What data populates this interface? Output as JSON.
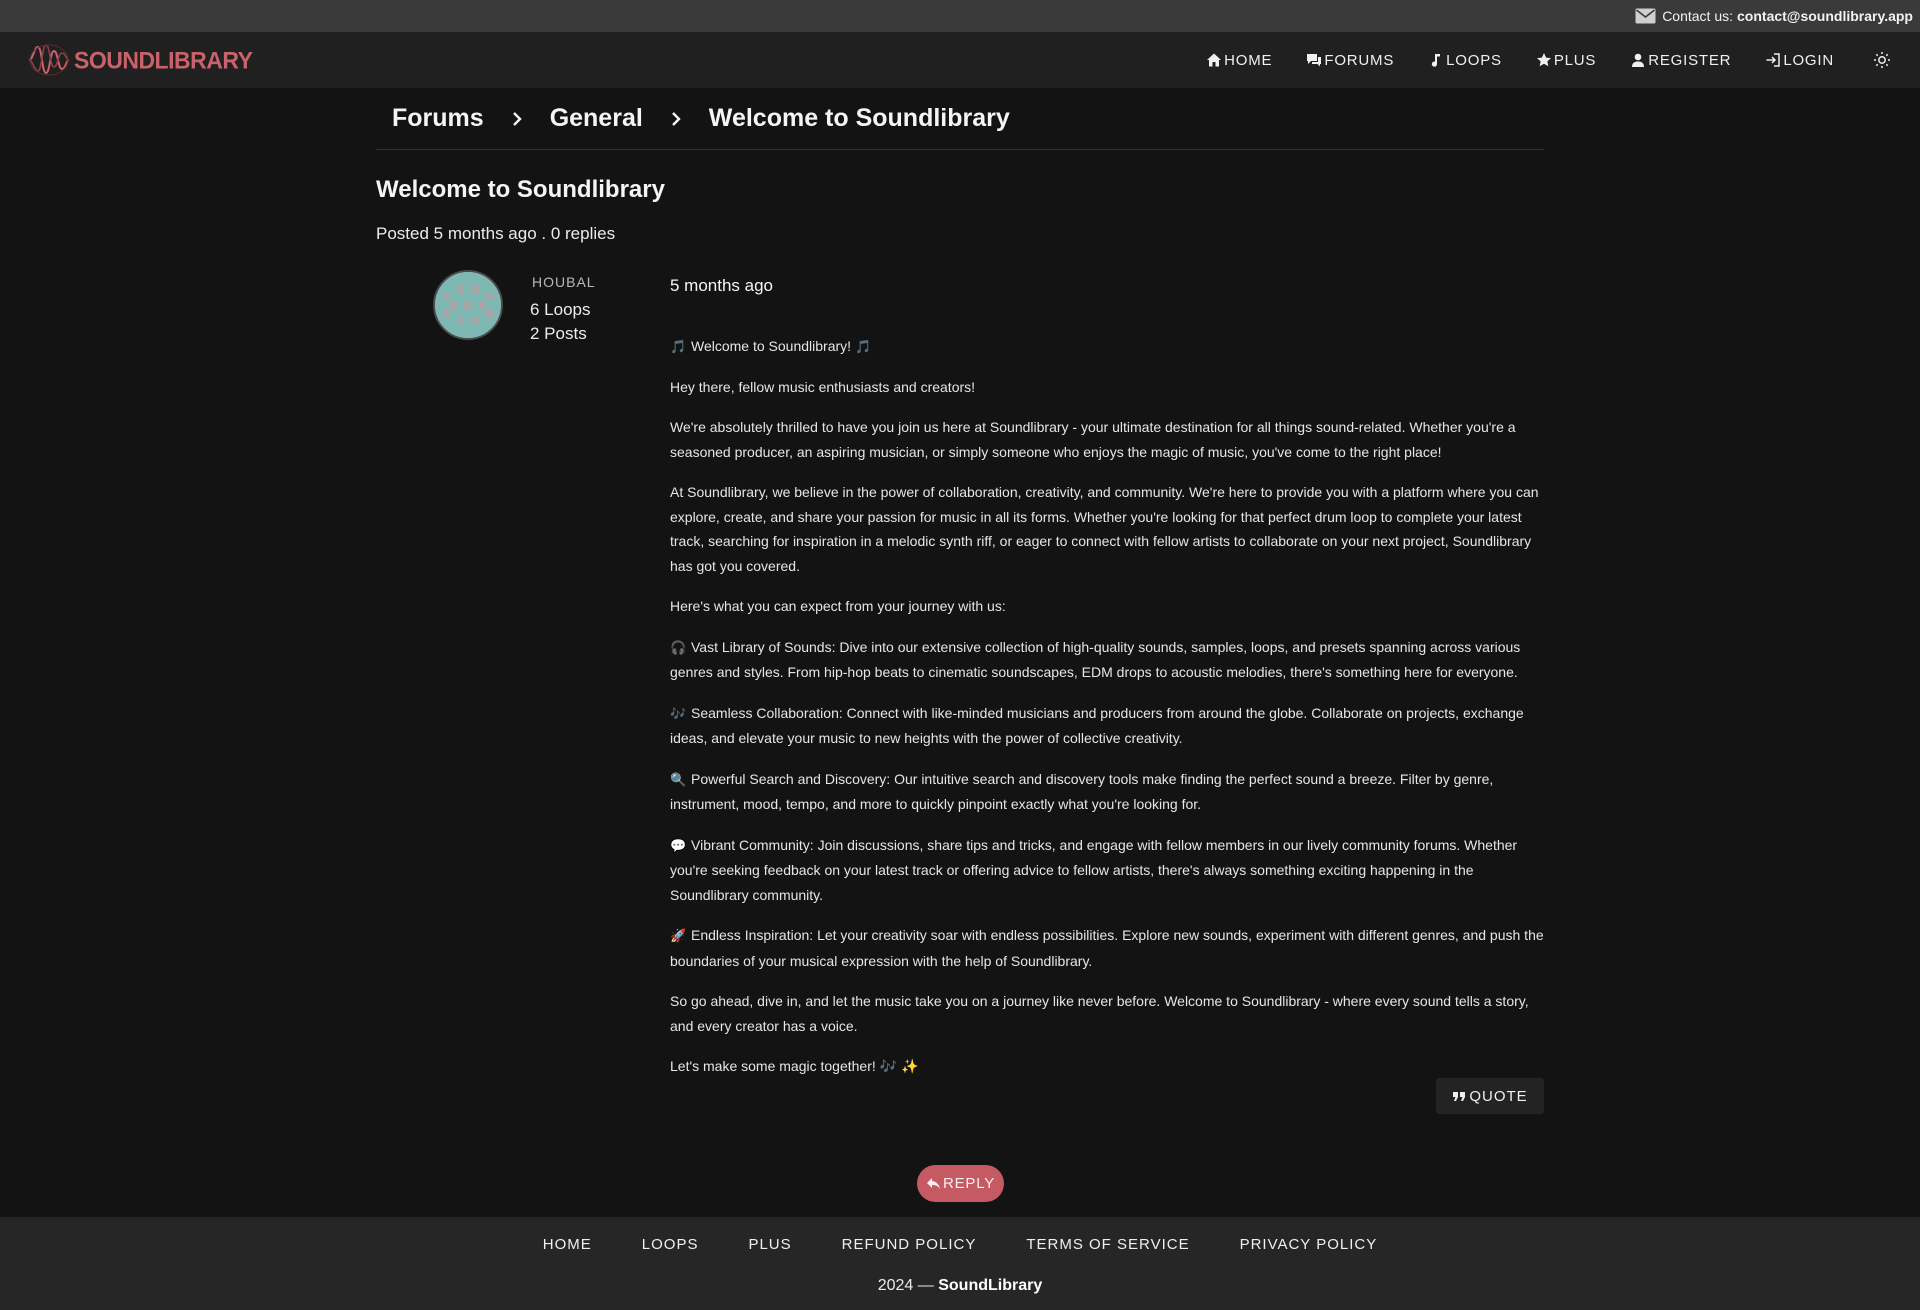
{
  "topbar": {
    "contact_label": "Contact us:",
    "contact_email": "contact@soundlibrary.app",
    "icon": "mail-icon"
  },
  "brand": {
    "name": "SOUNDLIBRARY",
    "color": "#c9626b"
  },
  "nav": {
    "items": [
      {
        "label": "HOME",
        "icon": "home-icon"
      },
      {
        "label": "FORUMS",
        "icon": "chat-icon"
      },
      {
        "label": "LOOPS",
        "icon": "music-note-icon"
      },
      {
        "label": "PLUS",
        "icon": "star-icon"
      },
      {
        "label": "REGISTER",
        "icon": "user-icon"
      },
      {
        "label": "LOGIN",
        "icon": "login-icon"
      }
    ],
    "theme_icon": "sun-icon"
  },
  "breadcrumb": [
    "Forums",
    "General",
    "Welcome to Soundlibrary"
  ],
  "thread": {
    "title": "Welcome to Soundlibrary",
    "meta": "Posted 5 months ago . 0 replies"
  },
  "post": {
    "author": {
      "name": "HOUBAL",
      "loops": "6 Loops",
      "posts": "2 Posts"
    },
    "time": "5 months ago",
    "paragraphs": [
      {
        "pre": "🎵",
        "text": "Welcome to Soundlibrary!",
        "post": "🎵"
      },
      {
        "pre": "",
        "text": "Hey there, fellow music enthusiasts and creators!",
        "post": ""
      },
      {
        "pre": "",
        "text": "We're absolutely thrilled to have you join us here at Soundlibrary - your ultimate destination for all things sound-related. Whether you're a seasoned producer, an aspiring musician, or simply someone who enjoys the magic of music, you've come to the right place!",
        "post": ""
      },
      {
        "pre": "",
        "text": "At Soundlibrary, we believe in the power of collaboration, creativity, and community. We're here to provide you with a platform where you can explore, create, and share your passion for music in all its forms. Whether you're looking for that perfect drum loop to complete your latest track, searching for inspiration in a melodic synth riff, or eager to connect with fellow artists to collaborate on your next project, Soundlibrary has got you covered.",
        "post": ""
      },
      {
        "pre": "",
        "text": "Here's what you can expect from your journey with us:",
        "post": ""
      },
      {
        "pre": "🎧",
        "text": "Vast Library of Sounds: Dive into our extensive collection of high-quality sounds, samples, loops, and presets spanning across various genres and styles. From hip-hop beats to cinematic soundscapes, EDM drops to acoustic melodies, there's something here for everyone.",
        "post": ""
      },
      {
        "pre": "🎶",
        "text": "Seamless Collaboration: Connect with like-minded musicians and producers from around the globe. Collaborate on projects, exchange ideas, and elevate your music to new heights with the power of collective creativity.",
        "post": ""
      },
      {
        "pre": "🔍",
        "text": "Powerful Search and Discovery: Our intuitive search and discovery tools make finding the perfect sound a breeze. Filter by genre, instrument, mood, tempo, and more to quickly pinpoint exactly what you're looking for.",
        "post": ""
      },
      {
        "pre": "💬",
        "text": "Vibrant Community: Join discussions, share tips and tricks, and engage with fellow members in our lively community forums. Whether you're seeking feedback on your latest track or offering advice to fellow artists, there's always something exciting happening in the Soundlibrary community.",
        "post": ""
      },
      {
        "pre": "🚀",
        "text": "Endless Inspiration: Let your creativity soar with endless possibilities. Explore new sounds, experiment with different genres, and push the boundaries of your musical expression with the help of Soundlibrary.",
        "post": ""
      },
      {
        "pre": "",
        "text": "So go ahead, dive in, and let the music take you on a journey like never before. Welcome to Soundlibrary - where every sound tells a story, and every creator has a voice.",
        "post": ""
      },
      {
        "pre": "",
        "text": "Let's make some magic together!",
        "post": "🎶 ✨"
      }
    ],
    "quote_label": "QUOTE"
  },
  "reply_label": "REPLY",
  "footer": {
    "links": [
      "HOME",
      "LOOPS",
      "PLUS",
      "REFUND POLICY",
      "TERMS OF SERVICE",
      "PRIVACY POLICY"
    ],
    "year": "2024 —",
    "brand": "SoundLibrary"
  },
  "colors": {
    "background": "#131313",
    "navbar": "#202020",
    "topbar": "#3a3a3a",
    "accent": "#c65a63",
    "avatar": "#7fb7b3"
  }
}
